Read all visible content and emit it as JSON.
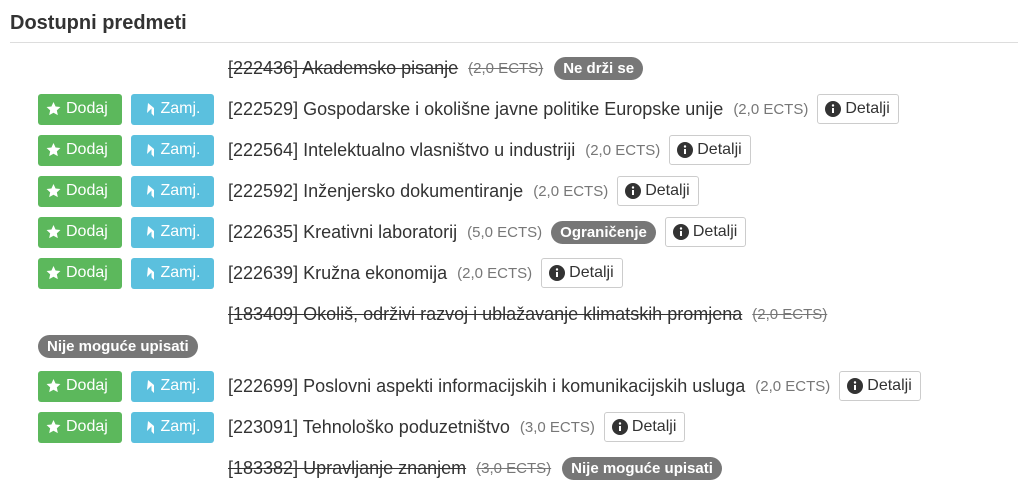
{
  "heading": "Dostupni predmeti",
  "buttons": {
    "add": "Dodaj",
    "swap": "Zamj.",
    "details": "Detalji"
  },
  "items": [
    {
      "code": "[222436] Akademsko pisanje",
      "ects": "(2,0 ECTS)",
      "struck": true,
      "badge": "Ne drži se"
    },
    {
      "code": "[222529] Gospodarske i okolišne javne politike Europske unije",
      "ects": "(2,0 ECTS)"
    },
    {
      "code": "[222564] Intelektualno vlasništvo u industriji",
      "ects": "(2,0 ECTS)"
    },
    {
      "code": "[222592] Inženjersko dokumentiranje",
      "ects": "(2,0 ECTS)"
    },
    {
      "code": "[222635] Kreativni laboratorij",
      "ects": "(5,0 ECTS)",
      "badge": "Ograničenje"
    },
    {
      "code": "[222639] Kružna ekonomija",
      "ects": "(2,0 ECTS)"
    },
    {
      "code": "[183409] Okoliš, održivi razvoj i ublažavanje klimatskih promjena",
      "ects": "(2,0 ECTS)",
      "struck": true,
      "badge": "Nije moguće upisati"
    },
    {
      "code": "[222699] Poslovni aspekti informacijskih i komunikacijskih usluga",
      "ects": "(2,0 ECTS)"
    },
    {
      "code": "[223091] Tehnološko poduzetništvo",
      "ects": "(3,0 ECTS)"
    },
    {
      "code": "[183382] Upravljanje znanjem",
      "ects": "(3,0 ECTS)",
      "struck": true,
      "badge": "Nije moguće upisati"
    }
  ]
}
